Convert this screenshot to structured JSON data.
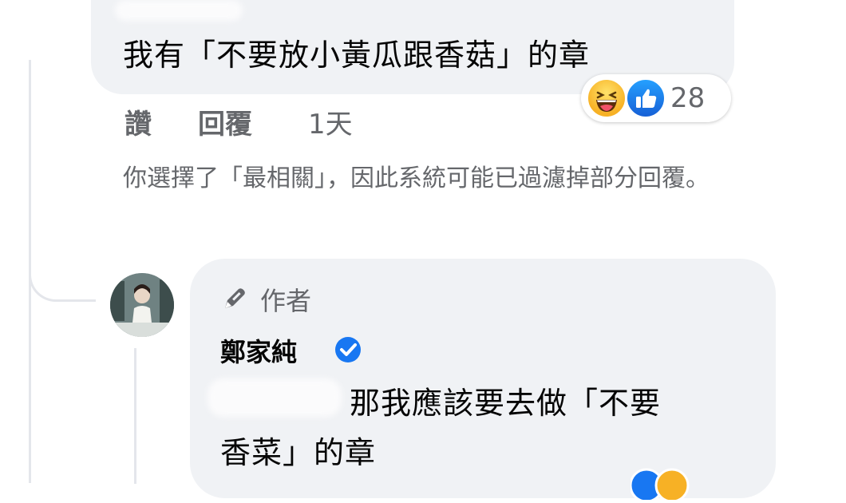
{
  "comment": {
    "text": "我有「不要放小黃瓜跟香菇」的章",
    "reactions": {
      "icons": [
        "laugh-reaction-icon",
        "like-reaction-icon"
      ],
      "count": "28"
    },
    "actions": {
      "like_label": "讚",
      "reply_label": "回覆",
      "time": "1天"
    }
  },
  "filter_notice": "你選擇了「最相關」，因此系統可能已過濾掉部分回覆。",
  "reply": {
    "badge_label": "作者",
    "badge_icon": "pencil-icon",
    "author_name": "鄭家純",
    "verified_icon": "verified-badge-icon",
    "text_line1": "那我應該要去做「不要",
    "text_line2": "香菜」的章"
  },
  "colors": {
    "bubble": "#f0f2f5",
    "secondary_text": "#65676b",
    "verified_blue": "#1877f2",
    "like_blue": "#1877f2",
    "laugh_yellow": "#f7b125"
  }
}
